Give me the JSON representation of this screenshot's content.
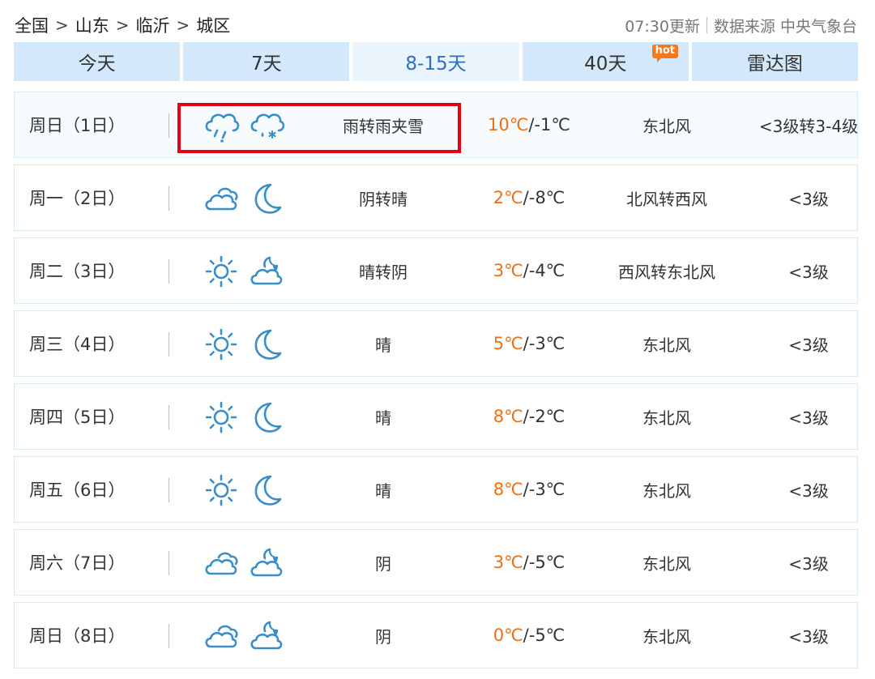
{
  "breadcrumb": {
    "items": [
      "全国",
      "山东",
      "临沂",
      "城区"
    ],
    "separator": ">"
  },
  "meta": {
    "update_time": "07:30更新",
    "source": "数据来源 中央气象台"
  },
  "tabs": [
    {
      "label": "今天",
      "active": false
    },
    {
      "label": "7天",
      "active": false
    },
    {
      "label": "8-15天",
      "active": true
    },
    {
      "label": "40天",
      "active": false,
      "badge": "hot"
    },
    {
      "label": "雷达图",
      "active": false
    }
  ],
  "colors": {
    "accent": "#2b6fc2",
    "icon": "#3a8ec7",
    "temp_high": "#ee6f12",
    "highlight": "#e60012",
    "tab_bg": "#d4e8fb"
  },
  "forecast": [
    {
      "day": "周日（1日）",
      "icon_day": "rain-icon",
      "icon_night": "sleet-icon",
      "desc": "雨转雨夹雪",
      "high": "10℃",
      "low": "/-1℃",
      "wind": "东北风",
      "level": "<3级转3-4级"
    },
    {
      "day": "周一（2日）",
      "icon_day": "cloudy-icon",
      "icon_night": "moon-icon",
      "desc": "阴转晴",
      "high": "2℃",
      "low": "/-8℃",
      "wind": "北风转西风",
      "level": "<3级"
    },
    {
      "day": "周二（3日）",
      "icon_day": "sun-icon",
      "icon_night": "night-cloudy-icon",
      "desc": "晴转阴",
      "high": "3℃",
      "low": "/-4℃",
      "wind": "西风转东北风",
      "level": "<3级"
    },
    {
      "day": "周三（4日）",
      "icon_day": "sun-icon",
      "icon_night": "moon-icon",
      "desc": "晴",
      "high": "5℃",
      "low": "/-3℃",
      "wind": "东北风",
      "level": "<3级"
    },
    {
      "day": "周四（5日）",
      "icon_day": "sun-icon",
      "icon_night": "moon-icon",
      "desc": "晴",
      "high": "8℃",
      "low": "/-2℃",
      "wind": "东北风",
      "level": "<3级"
    },
    {
      "day": "周五（6日）",
      "icon_day": "sun-icon",
      "icon_night": "moon-icon",
      "desc": "晴",
      "high": "8℃",
      "low": "/-3℃",
      "wind": "东北风",
      "level": "<3级"
    },
    {
      "day": "周六（7日）",
      "icon_day": "cloudy-icon",
      "icon_night": "night-cloudy-icon",
      "desc": "阴",
      "high": "3℃",
      "low": "/-5℃",
      "wind": "东北风",
      "level": "<3级"
    },
    {
      "day": "周日（8日）",
      "icon_day": "cloudy-icon",
      "icon_night": "night-cloudy-icon",
      "desc": "阴",
      "high": "0℃",
      "low": "/-5℃",
      "wind": "东北风",
      "level": "<3级"
    }
  ]
}
